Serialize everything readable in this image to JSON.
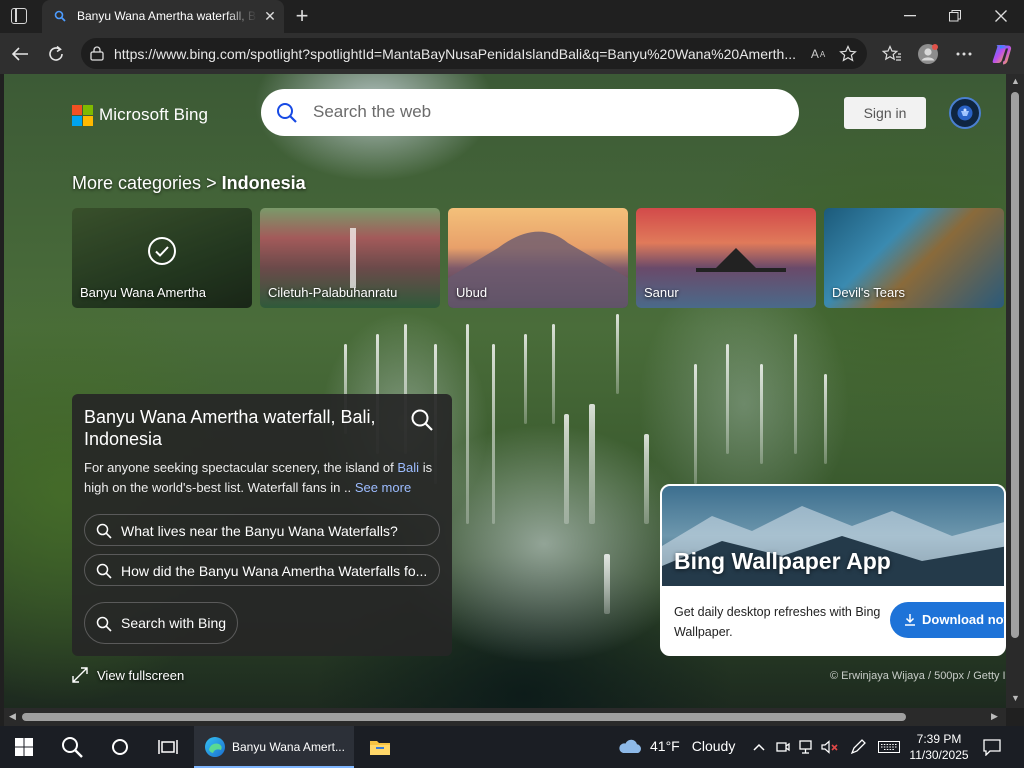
{
  "browser": {
    "tab_title": "Banyu Wana Amertha waterfall, Bali",
    "url": "https://www.bing.com/spotlight?spotlightId=MantaBayNusaPenidaIslandBali&q=Banyu%20Wana%20Amerth...",
    "icons": [
      "sidebar-icon",
      "bing-favicon",
      "close-icon",
      "plus-icon",
      "minimize-icon",
      "restore-icon",
      "back-icon",
      "refresh-icon",
      "lock-icon",
      "read-aloud-icon",
      "favorite-star-icon",
      "favorites-icon",
      "profile-icon",
      "more-icon",
      "copilot-icon"
    ]
  },
  "header": {
    "logo_text": "Microsoft Bing",
    "search_placeholder": "Search the web",
    "signin_label": "Sign in"
  },
  "breadcrumb": {
    "parent": "More categories",
    "separator": ">",
    "current": "Indonesia"
  },
  "cards": [
    {
      "label": "Banyu Wana Amertha",
      "selected": true
    },
    {
      "label": "Ciletuh-Palabuhanratu"
    },
    {
      "label": "Ubud"
    },
    {
      "label": "Sanur"
    },
    {
      "label": "Devil's Tears"
    }
  ],
  "info": {
    "title": "Banyu Wana Amertha waterfall, Bali, Indonesia",
    "desc_before": "For anyone seeking spectacular scenery, the island of ",
    "desc_link": "Bali",
    "desc_after": " is high on the world's-best list. Waterfall fans in ..",
    "see_more": "See more",
    "questions": [
      "What lives near the Banyu Wana Waterfalls?",
      "How did the Banyu Wana Amertha Waterfalls fo..."
    ],
    "search_button": "Search with Bing"
  },
  "view_fullscreen": "View fullscreen",
  "promo": {
    "title": "Bing Wallpaper App",
    "desc": "Get daily desktop refreshes with Bing Wallpaper.",
    "button": "Download now"
  },
  "copyright": "© Erwinjaya Wijaya / 500px / Getty I",
  "taskbar": {
    "edge_label": "Banyu Wana Amert...",
    "weather_temp": "41°F",
    "weather_desc": "Cloudy",
    "time": "7:39 PM",
    "date": "11/30/2025"
  },
  "colors": {
    "accent": "#1e73d8",
    "link": "#9dbcff",
    "chrome_dark": "#202020",
    "taskbar": "#1b1e24"
  }
}
